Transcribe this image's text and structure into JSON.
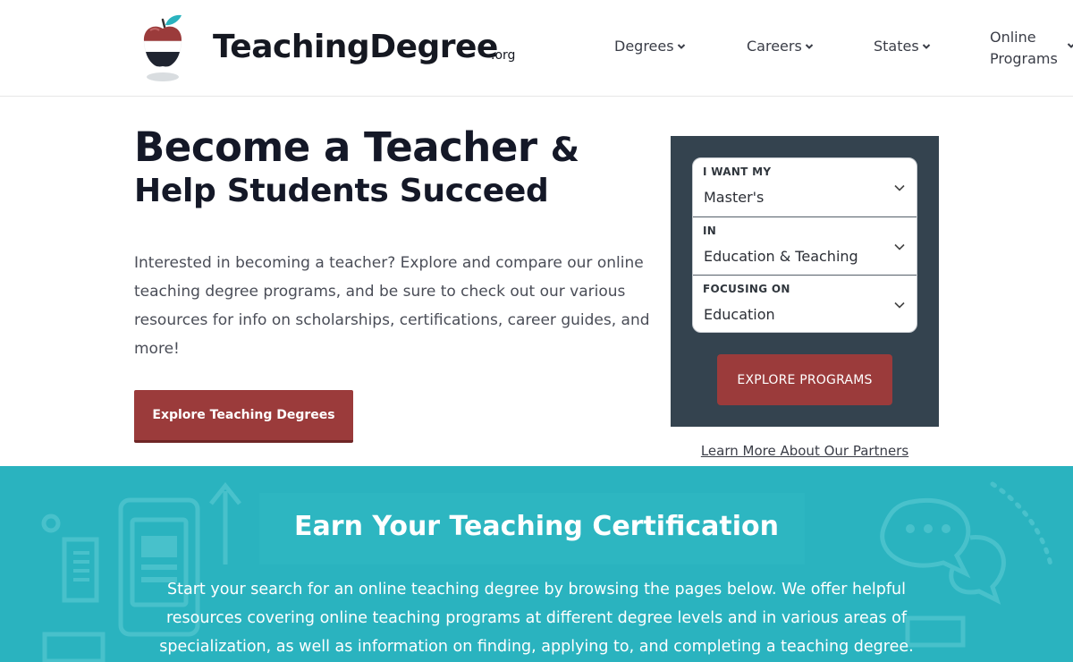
{
  "header": {
    "logo_text": "TeachingDegree",
    "logo_tld": ".org",
    "logo_icon": "apple-icon",
    "nav": [
      {
        "label": "Degrees"
      },
      {
        "label": "Careers"
      },
      {
        "label": "States"
      },
      {
        "label": "Online Programs"
      }
    ]
  },
  "hero": {
    "title_line1": "Become a Teacher",
    "title_amp": "&",
    "title_line2": "Help Students Succeed",
    "description": "Interested in becoming a teacher? Explore and compare our online teaching degree programs, and be sure to check out our various resources for info on scholarships, certifications, career guides, and more!",
    "button_label": "Explore Teaching Degrees"
  },
  "search_panel": {
    "fields": [
      {
        "label": "I WANT MY",
        "value": "Master's"
      },
      {
        "label": "IN",
        "value": "Education & Teaching"
      },
      {
        "label": "FOCUSING ON",
        "value": "Education"
      }
    ],
    "button_label": "EXPLORE PROGRAMS",
    "partners_link": "Learn More About Our Partners"
  },
  "certification": {
    "title": "Earn Your Teaching Certification",
    "description": "Start your search for an online teaching degree by browsing the pages below. We offer helpful resources covering online teaching programs at different degree levels and in various areas of specialization, as well as information on finding, applying to, and completing a teaching degree."
  },
  "colors": {
    "brand_red": "#9b3b3b",
    "panel_bg": "#34434f",
    "teal": "#2ab3bf",
    "heading": "#141827"
  }
}
